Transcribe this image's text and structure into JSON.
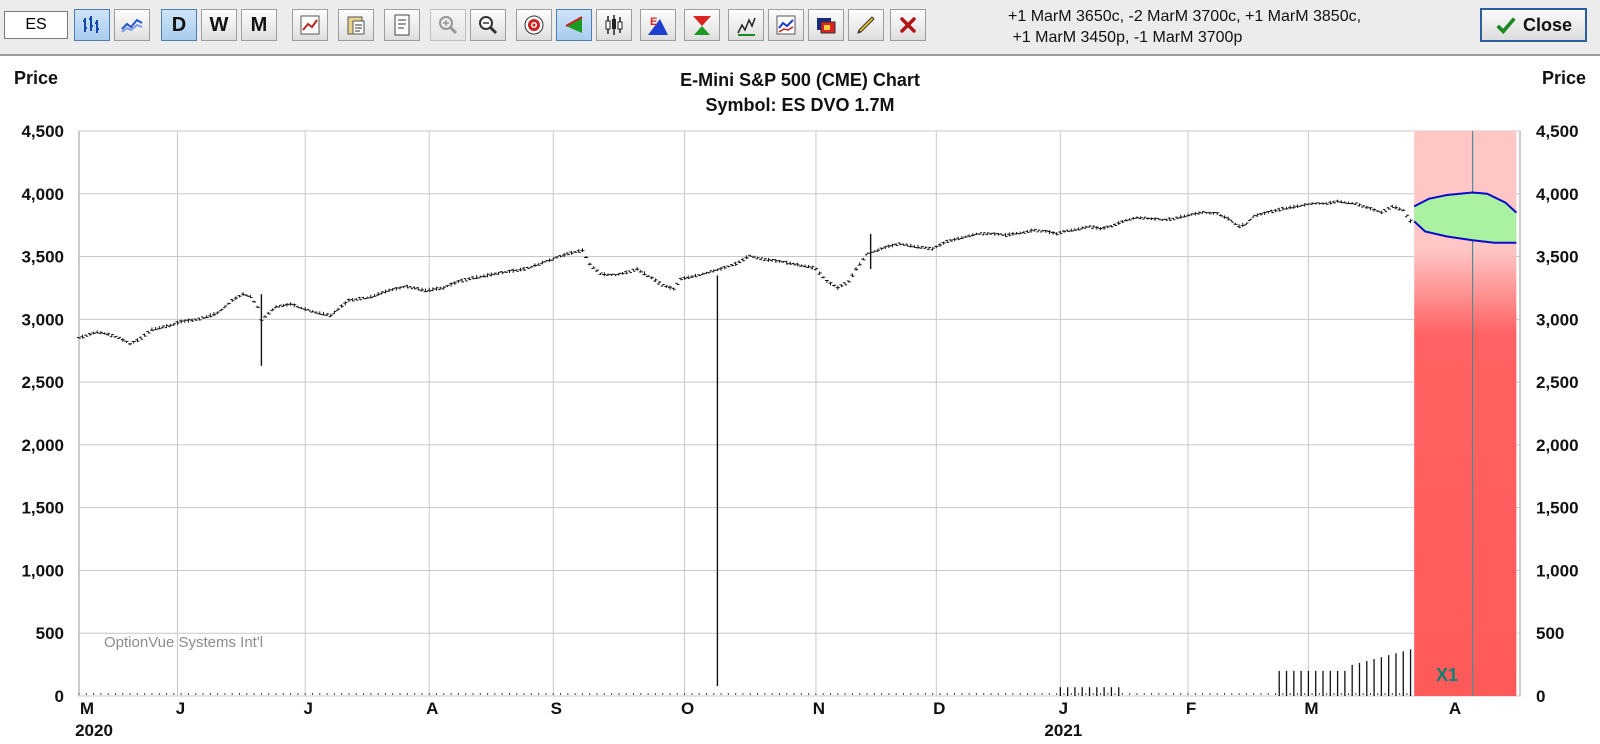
{
  "toolbar": {
    "symbol_value": "ES",
    "buttons": [
      {
        "name": "bar-chart-icon",
        "state": "on"
      },
      {
        "name": "line-chart-icon",
        "state": "normal"
      },
      {
        "name": "daily-button",
        "label": "D",
        "state": "on"
      },
      {
        "name": "weekly-button",
        "label": "W",
        "state": "normal"
      },
      {
        "name": "monthly-button",
        "label": "M",
        "state": "normal"
      },
      {
        "name": "edit-chart-icon",
        "state": "normal"
      },
      {
        "name": "paste-icon",
        "state": "normal"
      },
      {
        "name": "report-icon",
        "state": "normal"
      },
      {
        "name": "zoom-in-icon",
        "state": "disabled"
      },
      {
        "name": "zoom-out-icon",
        "state": "normal"
      },
      {
        "name": "target-icon",
        "state": "normal"
      },
      {
        "name": "cursor-icon",
        "state": "on"
      },
      {
        "name": "candlestick-icon",
        "state": "normal"
      },
      {
        "name": "earnings-icon",
        "state": "normal"
      },
      {
        "name": "dividend-icon",
        "state": "normal"
      },
      {
        "name": "volume-icon",
        "state": "normal"
      },
      {
        "name": "indicator-icon",
        "state": "normal"
      },
      {
        "name": "color-icon",
        "state": "normal"
      },
      {
        "name": "pencil-icon",
        "state": "normal"
      },
      {
        "name": "delete-icon",
        "state": "normal"
      }
    ],
    "strategy_line1": "+1 MarM 3650c, -2 MarM 3700c, +1 MarM 3850c,",
    "strategy_line2": "+1 MarM 3450p, -1 MarM 3700p",
    "close_label": "Close"
  },
  "chart": {
    "title": "E-Mini S&P 500 (CME) Chart",
    "subtitle": "Symbol: ES  DVO 1.7M",
    "left_axis_label": "Price",
    "right_axis_label": "Price",
    "watermark": "OptionVue Systems Int'l",
    "expiry_marker": "X1",
    "colors": {
      "bars": "#111111",
      "band_blue": "#0a0acc",
      "band_fill": "#a8f0a0",
      "risk_red": "#ff5e5e",
      "risk_pink": "#ffc4c4"
    }
  },
  "chart_data": {
    "type": "bar",
    "ylim": [
      0,
      4500
    ],
    "yticks": [
      "4,500",
      "4,000",
      "3,500",
      "3,000",
      "2,500",
      "2,000",
      "1,500",
      "1,000",
      "500",
      "0"
    ],
    "xticks": [
      "M",
      "J",
      "J",
      "A",
      "S",
      "O",
      "N",
      "D",
      "J",
      "F",
      "M",
      "A"
    ],
    "year_labels": [
      "2020",
      "2021"
    ],
    "price_path": [
      [
        0,
        2850
      ],
      [
        5,
        2900
      ],
      [
        8,
        2880
      ],
      [
        11,
        2850
      ],
      [
        14,
        2800
      ],
      [
        17,
        2850
      ],
      [
        20,
        2920
      ],
      [
        25,
        2950
      ],
      [
        28,
        2980
      ],
      [
        33,
        3000
      ],
      [
        38,
        3050
      ],
      [
        42,
        3150
      ],
      [
        45,
        3200
      ],
      [
        47,
        3180
      ],
      [
        49,
        3100
      ],
      [
        50,
        3000
      ],
      [
        52,
        3050
      ],
      [
        54,
        3100
      ],
      [
        58,
        3120
      ],
      [
        62,
        3080
      ],
      [
        66,
        3050
      ],
      [
        69,
        3030
      ],
      [
        71,
        3080
      ],
      [
        74,
        3150
      ],
      [
        80,
        3180
      ],
      [
        85,
        3230
      ],
      [
        90,
        3260
      ],
      [
        95,
        3230
      ],
      [
        100,
        3250
      ],
      [
        104,
        3300
      ],
      [
        108,
        3330
      ],
      [
        112,
        3350
      ],
      [
        118,
        3380
      ],
      [
        122,
        3400
      ],
      [
        126,
        3440
      ],
      [
        130,
        3480
      ],
      [
        134,
        3520
      ],
      [
        138,
        3550
      ],
      [
        140,
        3440
      ],
      [
        143,
        3360
      ],
      [
        147,
        3350
      ],
      [
        151,
        3380
      ],
      [
        153,
        3400
      ],
      [
        157,
        3330
      ],
      [
        160,
        3270
      ],
      [
        163,
        3240
      ],
      [
        165,
        3320
      ],
      [
        168,
        3340
      ],
      [
        172,
        3370
      ],
      [
        176,
        3400
      ],
      [
        180,
        3440
      ],
      [
        184,
        3510
      ],
      [
        187,
        3480
      ],
      [
        192,
        3460
      ],
      [
        196,
        3440
      ],
      [
        200,
        3420
      ],
      [
        202,
        3400
      ],
      [
        205,
        3300
      ],
      [
        208,
        3250
      ],
      [
        211,
        3300
      ],
      [
        213,
        3400
      ],
      [
        216,
        3520
      ],
      [
        219,
        3550
      ],
      [
        222,
        3580
      ],
      [
        225,
        3600
      ],
      [
        229,
        3580
      ],
      [
        232,
        3570
      ],
      [
        234,
        3560
      ],
      [
        238,
        3620
      ],
      [
        242,
        3650
      ],
      [
        246,
        3680
      ],
      [
        250,
        3680
      ],
      [
        254,
        3670
      ],
      [
        258,
        3690
      ],
      [
        262,
        3710
      ],
      [
        265,
        3700
      ],
      [
        268,
        3680
      ],
      [
        270,
        3700
      ],
      [
        274,
        3720
      ],
      [
        277,
        3740
      ],
      [
        280,
        3720
      ],
      [
        283,
        3740
      ],
      [
        287,
        3790
      ],
      [
        290,
        3810
      ],
      [
        294,
        3800
      ],
      [
        297,
        3790
      ],
      [
        300,
        3800
      ],
      [
        304,
        3830
      ],
      [
        308,
        3850
      ],
      [
        312,
        3840
      ],
      [
        315,
        3800
      ],
      [
        318,
        3740
      ],
      [
        320,
        3760
      ],
      [
        322,
        3820
      ],
      [
        326,
        3850
      ],
      [
        330,
        3880
      ],
      [
        334,
        3900
      ],
      [
        338,
        3920
      ],
      [
        342,
        3920
      ],
      [
        345,
        3940
      ],
      [
        350,
        3920
      ],
      [
        354,
        3880
      ],
      [
        357,
        3850
      ],
      [
        360,
        3900
      ],
      [
        363,
        3870
      ],
      [
        365,
        3780
      ]
    ],
    "spikes": [
      [
        50,
        2630,
        3200
      ],
      [
        175,
        80,
        3350
      ],
      [
        217,
        3400,
        3680
      ]
    ],
    "volume_bars": [
      {
        "from": 269,
        "to": 285,
        "step": 2,
        "value": 70
      },
      {
        "from": 329,
        "to": 348,
        "step": 2,
        "value": 200
      },
      {
        "from": 349,
        "to": 366,
        "step": 2,
        "value": 330
      }
    ],
    "projection_band": {
      "start_x": 366,
      "end_x": 394,
      "expiry_x": 382,
      "upper": [
        [
          366,
          3900
        ],
        [
          370,
          3960
        ],
        [
          375,
          3990
        ],
        [
          382,
          4010
        ],
        [
          386,
          4000
        ],
        [
          391,
          3930
        ],
        [
          394,
          3850
        ]
      ],
      "lower": [
        [
          366,
          3780
        ],
        [
          369,
          3700
        ],
        [
          375,
          3660
        ],
        [
          382,
          3630
        ],
        [
          388,
          3610
        ],
        [
          394,
          3610
        ]
      ]
    }
  }
}
